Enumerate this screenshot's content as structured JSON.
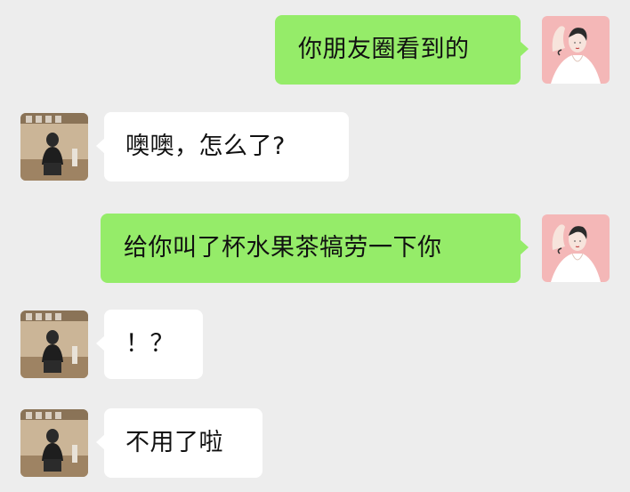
{
  "chat": {
    "messages": [
      {
        "sender": "self",
        "text": "你朋友圈看到的"
      },
      {
        "sender": "other",
        "text": "噢噢，怎么了?"
      },
      {
        "sender": "self",
        "text": "给你叫了杯水果茶犒劳一下你"
      },
      {
        "sender": "other",
        "text": "！？"
      },
      {
        "sender": "other",
        "text": "不用了啦"
      }
    ]
  },
  "colors": {
    "background": "#ededed",
    "self_bubble": "#95ec69",
    "other_bubble": "#ffffff",
    "text": "#111111"
  },
  "icons": {
    "self_avatar": "woman-illustration-avatar",
    "other_avatar": "person-photo-avatar"
  }
}
